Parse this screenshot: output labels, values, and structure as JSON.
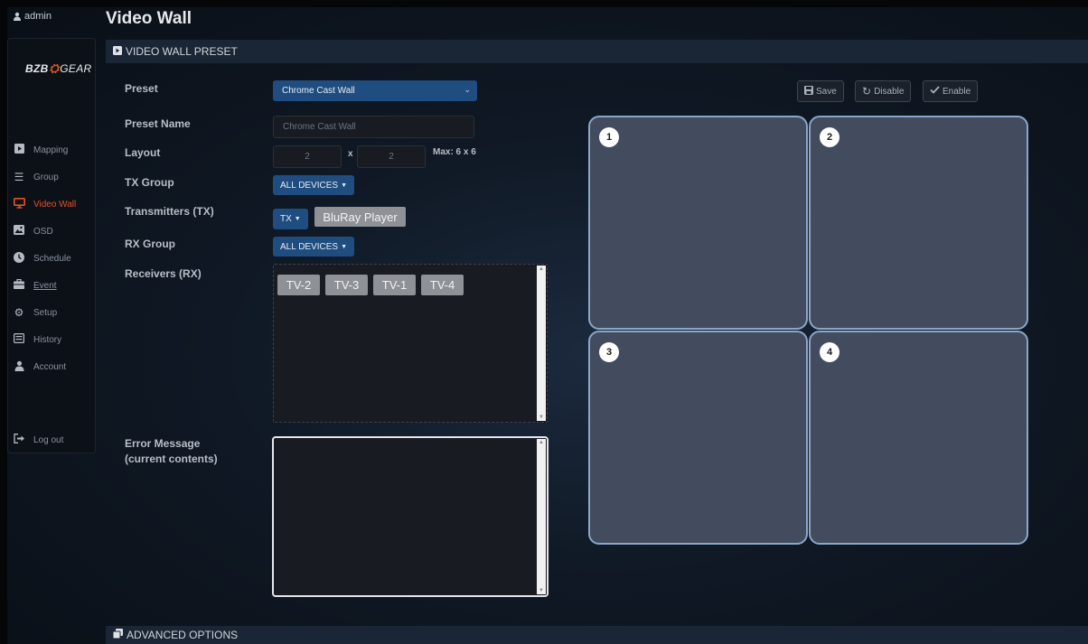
{
  "header": {
    "user": "admin",
    "title": "Video Wall"
  },
  "sidebar": {
    "logo": {
      "left": "BZB",
      "right": "GEAR"
    },
    "items": [
      {
        "label": "Mapping",
        "icon": "play-square-icon"
      },
      {
        "label": "Group",
        "icon": "list-icon"
      },
      {
        "label": "Video Wall",
        "icon": "monitor-icon",
        "active": true
      },
      {
        "label": "OSD",
        "icon": "image-icon"
      },
      {
        "label": "Schedule",
        "icon": "clock-icon"
      },
      {
        "label": "Event",
        "icon": "briefcase-icon"
      },
      {
        "label": "Setup",
        "icon": "gear-icon"
      },
      {
        "label": "History",
        "icon": "list-box-icon"
      },
      {
        "label": "Account",
        "icon": "user-icon"
      }
    ],
    "logout": "Log out"
  },
  "preset_panel": {
    "title": "VIDEO WALL PRESET",
    "labels": {
      "preset": "Preset",
      "preset_name": "Preset Name",
      "layout": "Layout",
      "tx_group": "TX Group",
      "transmitters": "Transmitters (TX)",
      "rx_group": "RX Group",
      "receivers": "Receivers (RX)",
      "error_message": "Error Message",
      "error_sub": "(current contents)"
    },
    "preset_select": "Chrome Cast Wall",
    "preset_name_placeholder": "Chrome Cast Wall",
    "layout_cols": "2",
    "layout_x": "x",
    "layout_rows": "2",
    "layout_max": "Max: 6 x 6",
    "tx_group_dropdown": "ALL DEVICES",
    "tx_dropdown": "TX",
    "tx_selected": "BluRay Player",
    "rx_group_dropdown": "ALL DEVICES",
    "receivers": [
      "TV-2",
      "TV-3",
      "TV-1",
      "TV-4"
    ],
    "error_message_value": "",
    "actions": {
      "save": "Save",
      "disable": "Disable",
      "enable": "Enable"
    },
    "wall_cells": [
      "1",
      "2",
      "3",
      "4"
    ]
  },
  "advanced_panel": {
    "title": "ADVANCED OPTIONS"
  },
  "colors": {
    "accent_active": "#e5512a",
    "button_blue": "#1f4d80",
    "cell_fill": "#434c5e",
    "cell_border": "#8aa6c8"
  }
}
